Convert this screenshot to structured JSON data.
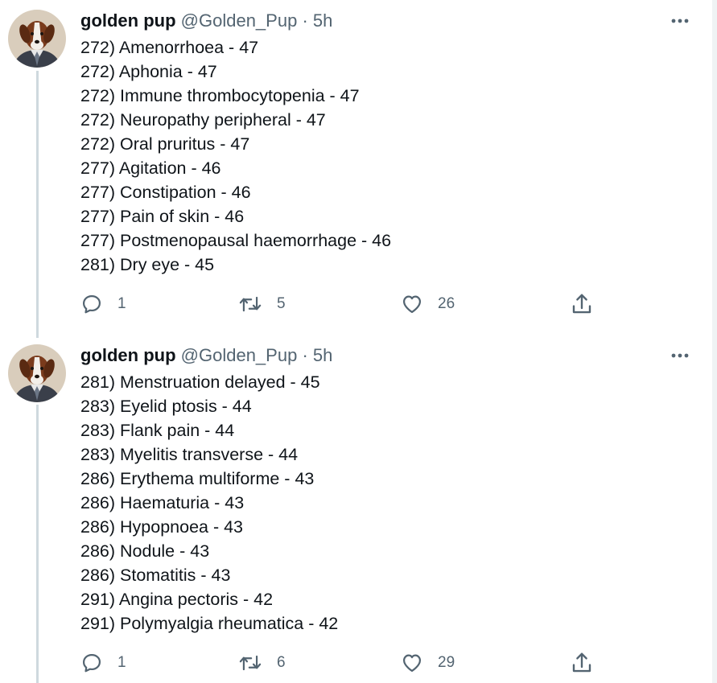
{
  "tweets": [
    {
      "author": {
        "name": "golden pup",
        "handle": "@Golden_Pup",
        "separator": "·",
        "time": "5h"
      },
      "lines": [
        "272) Amenorrhoea - 47",
        "272) Aphonia - 47",
        "272) Immune thrombocytopenia - 47",
        "272) Neuropathy peripheral - 47",
        "272) Oral pruritus - 47",
        "277) Agitation - 46",
        "277) Constipation - 46",
        "277) Pain of skin - 46",
        "277) Postmenopausal haemorrhage - 46",
        "281) Dry eye - 45"
      ],
      "actions": {
        "reply_count": "1",
        "retweet_count": "5",
        "like_count": "26"
      }
    },
    {
      "author": {
        "name": "golden pup",
        "handle": "@Golden_Pup",
        "separator": "·",
        "time": "5h"
      },
      "lines": [
        "281) Menstruation delayed - 45",
        "283) Eyelid ptosis - 44",
        "283) Flank pain - 44",
        "283) Myelitis transverse - 44",
        "286) Erythema multiforme - 43",
        "286) Haematuria - 43",
        "286) Hypopnoea - 43",
        "286) Nodule - 43",
        "286) Stomatitis - 43",
        "291) Angina pectoris - 42",
        "291) Polymyalgia rheumatica - 42"
      ],
      "actions": {
        "reply_count": "1",
        "retweet_count": "6",
        "like_count": "29"
      }
    }
  ],
  "icons": {
    "more": "more-horizontal-icon",
    "reply": "reply-icon",
    "retweet": "retweet-icon",
    "like": "heart-icon",
    "share": "share-icon"
  },
  "colors": {
    "text": "#0f1419",
    "secondary": "#536471",
    "thread_line": "#cfd9de"
  }
}
